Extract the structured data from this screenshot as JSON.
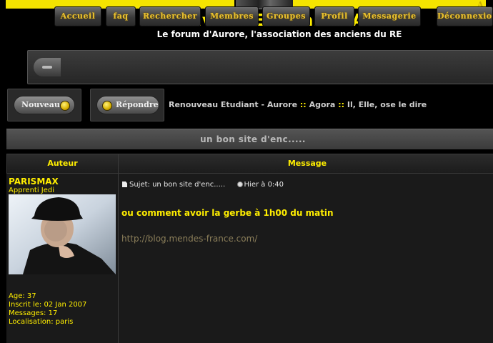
{
  "banner": {
    "corner_mark": "A"
  },
  "header": {
    "title": "Renouveau Etudiant - Aurore",
    "subtitle": "Le forum d'Aurore, l'association des anciens du RE"
  },
  "nav": {
    "items": [
      {
        "label": "Accueil"
      },
      {
        "label": "faq"
      },
      {
        "label": "Rechercher"
      },
      {
        "label": "Membres"
      },
      {
        "label": "Groupes"
      },
      {
        "label": "Profil"
      },
      {
        "label": "Messagerie"
      },
      {
        "label": "Déconnexion"
      }
    ]
  },
  "actions": {
    "new_label": "Nouveau",
    "reply_label": "Répondre"
  },
  "breadcrumb": {
    "items": [
      "Renouveau Etudiant - Aurore",
      "Agora",
      "Il, Elle, ose le dire"
    ],
    "separator": "::"
  },
  "topic": {
    "title": "un bon site d'enc.....",
    "col_author": "Auteur",
    "col_message": "Message"
  },
  "post": {
    "author": "PARISMAX",
    "rank": "Apprenti Jedi",
    "avatar_icon": "user-photo-icon",
    "age": "Age: 37",
    "joined": "Inscrit le: 02 Jan 2007",
    "messages": "Messages: 17",
    "location": "Localisation: paris",
    "subject": "Sujet: un bon site d'enc.....",
    "time": "Hier à 0:40",
    "body": "ou comment avoir la gerbe à 1h00 du matin",
    "link": "http://blog.mendes-france.com/"
  },
  "colors": {
    "accent_yellow": "#ffee00",
    "background": "#000000",
    "panel": "#1a1a1a"
  }
}
